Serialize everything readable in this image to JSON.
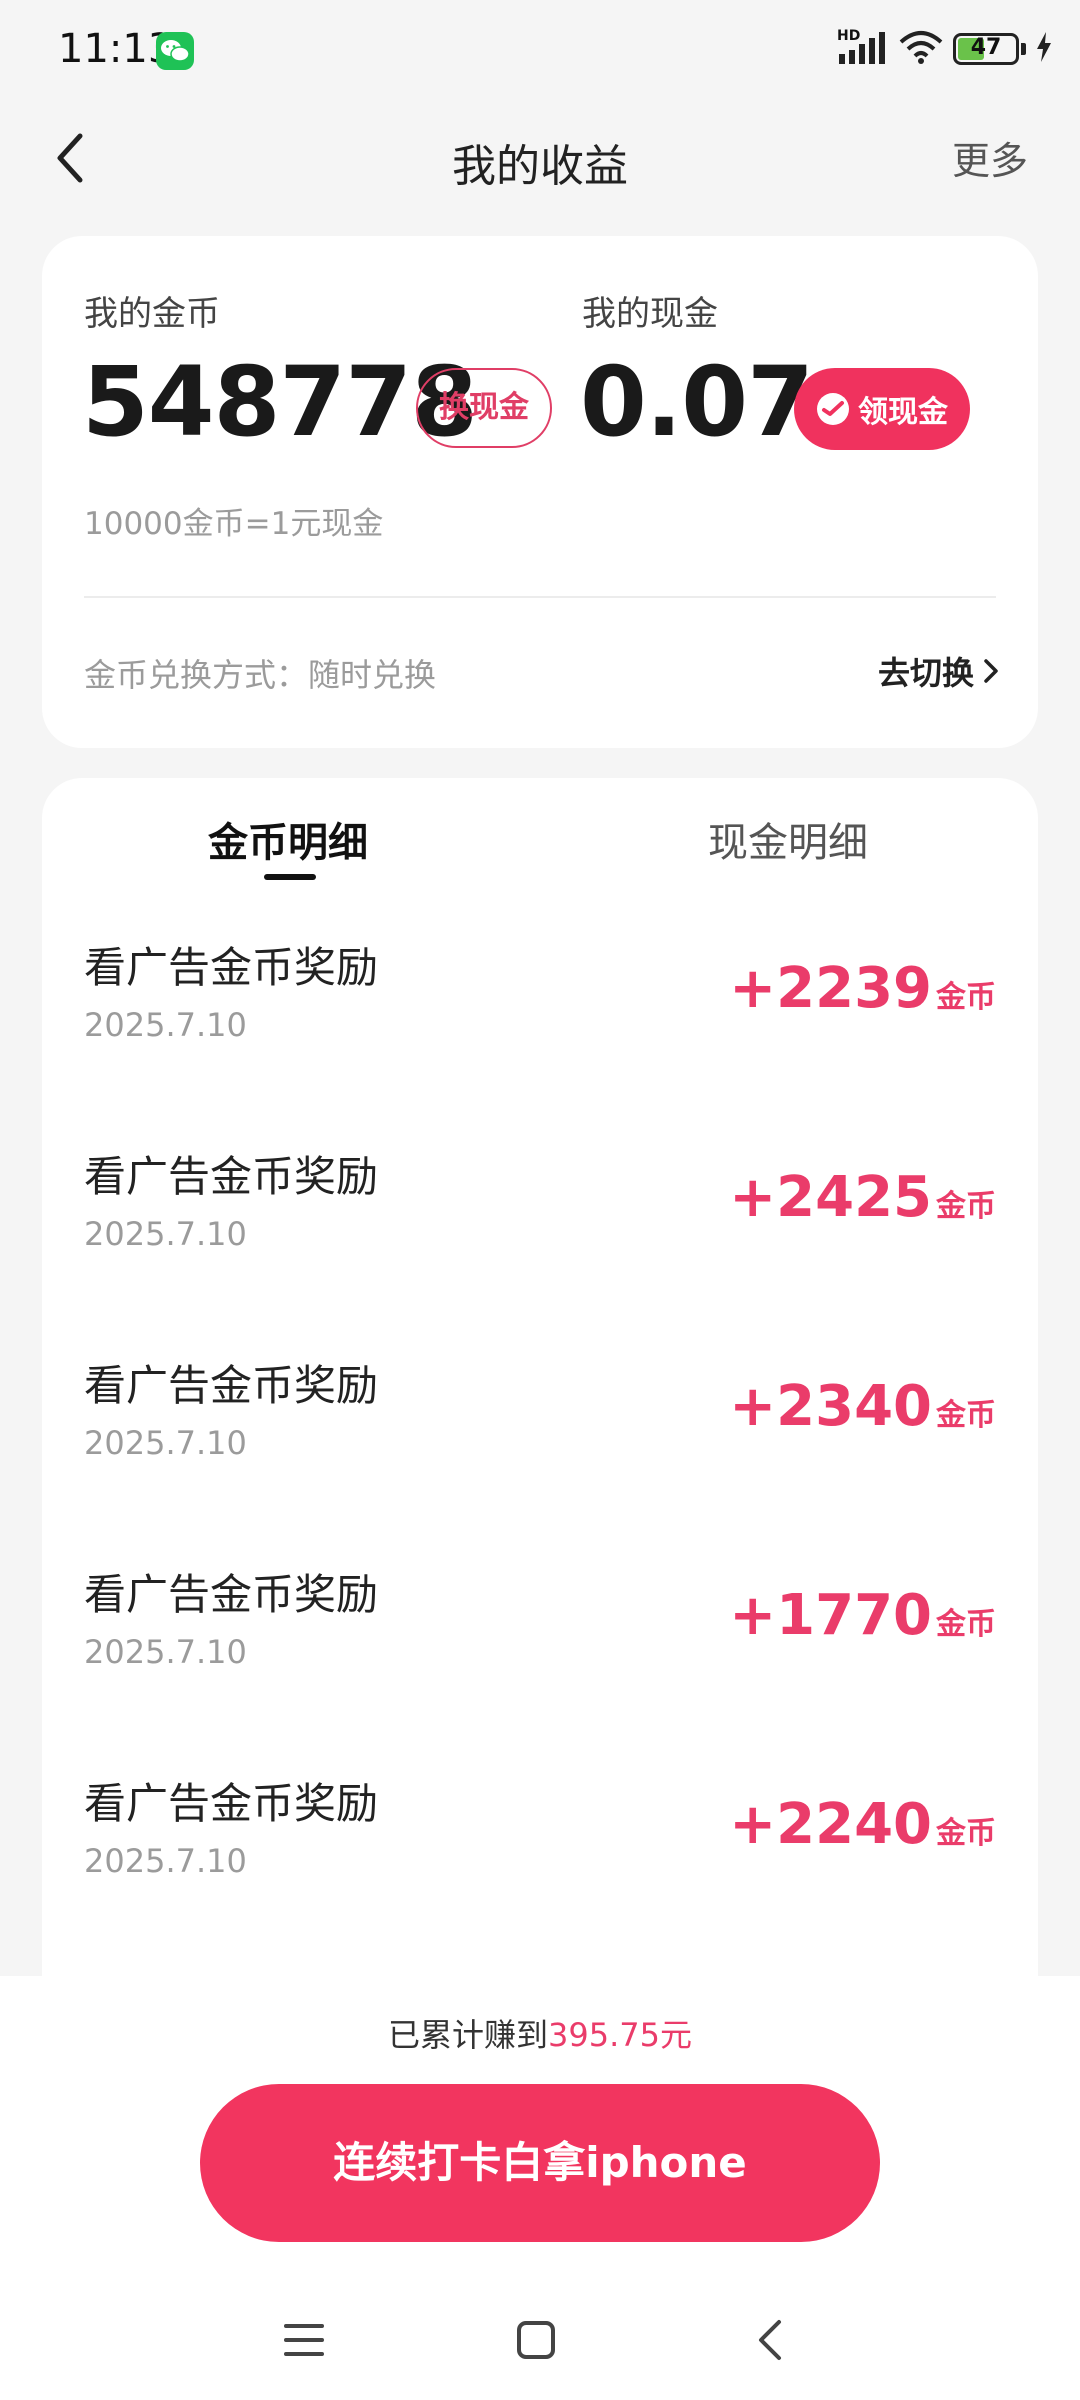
{
  "status_bar": {
    "time": "11:13",
    "network_label": "HD",
    "battery_level": "47",
    "battery_fraction": 0.47
  },
  "header": {
    "title": "我的收益",
    "more_label": "更多"
  },
  "balance_card": {
    "coins_label": "我的金币",
    "coins_value": "548778",
    "exchange_label": "换现金",
    "cash_label": "我的现金",
    "cash_value": "0.07",
    "withdraw_label": "领现金",
    "rate_note": "10000金币=1元现金",
    "method_text": "金币兑换方式：随时兑换",
    "switch_label": "去切换"
  },
  "tabs": [
    {
      "label": "金币明细",
      "active": true
    },
    {
      "label": "现金明细",
      "active": false
    }
  ],
  "records": [
    {
      "title": "看广告金币奖励",
      "date": "2025.7.10",
      "amount": "+2239",
      "unit": "金币"
    },
    {
      "title": "看广告金币奖励",
      "date": "2025.7.10",
      "amount": "+2425",
      "unit": "金币"
    },
    {
      "title": "看广告金币奖励",
      "date": "2025.7.10",
      "amount": "+2340",
      "unit": "金币"
    },
    {
      "title": "看广告金币奖励",
      "date": "2025.7.10",
      "amount": "+1770",
      "unit": "金币"
    },
    {
      "title": "看广告金币奖励",
      "date": "2025.7.10",
      "amount": "+2240",
      "unit": "金币"
    }
  ],
  "footer": {
    "cumulative_prefix": "已累计赚到",
    "cumulative_amount": "395.75元",
    "checkin_label": "连续打卡白拿iphone"
  },
  "colors": {
    "accent": "#f2355f",
    "amount": "#ea3c6a",
    "background": "#f5f5f5"
  },
  "icons": [
    "wechat-icon",
    "signal-icon",
    "wifi-icon",
    "battery-icon",
    "charging-icon",
    "back-icon",
    "chevron-right-icon",
    "wallet-icon",
    "menu-icon",
    "home-icon",
    "nav-back-icon"
  ]
}
